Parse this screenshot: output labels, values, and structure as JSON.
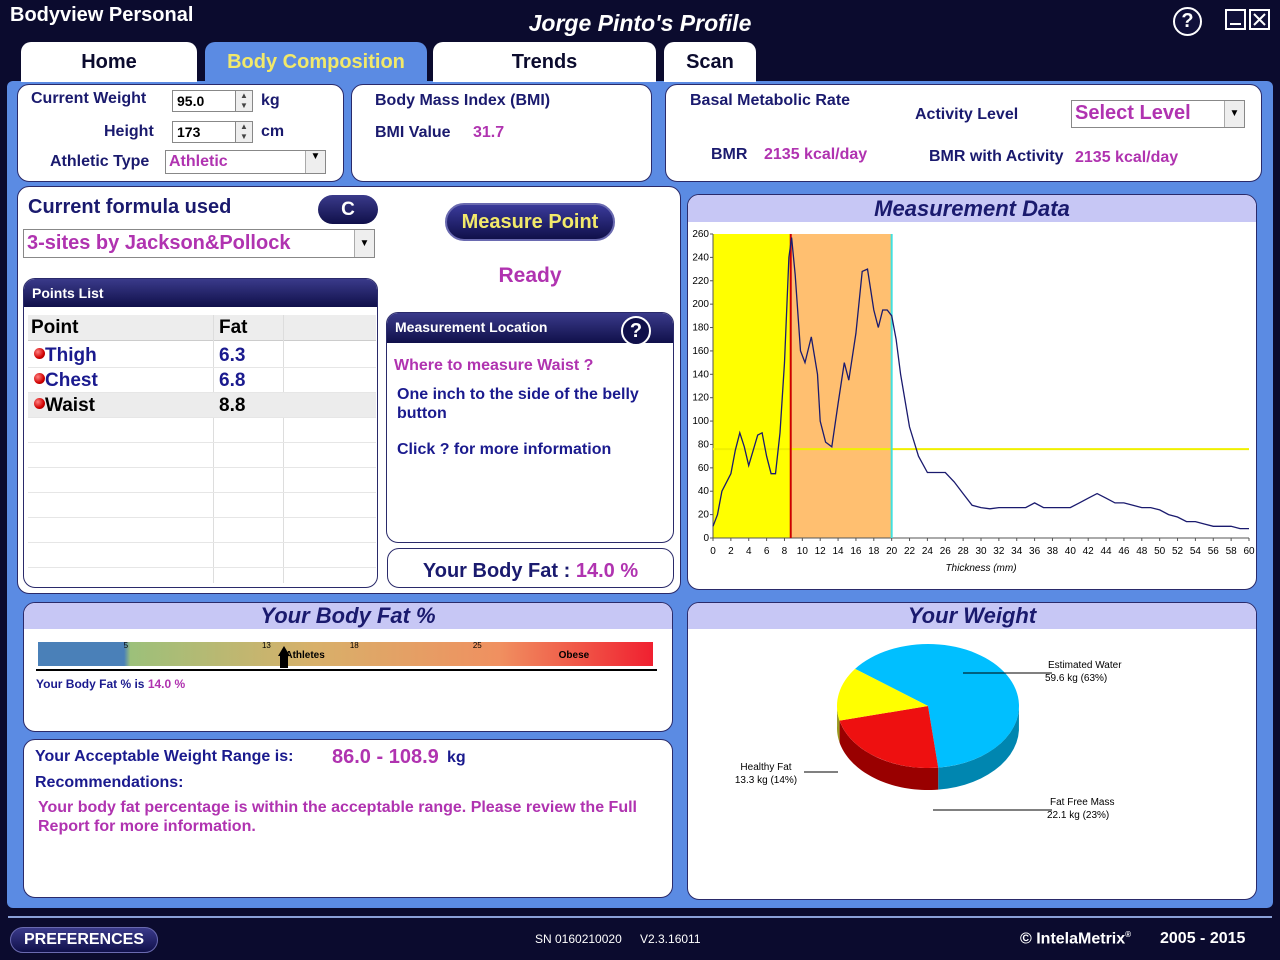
{
  "window": {
    "app_name": "Bodyview Personal",
    "profile_title": "Jorge Pinto's Profile",
    "help": "?"
  },
  "tabs": [
    {
      "label": "Home"
    },
    {
      "label": "Body Composition",
      "active": true
    },
    {
      "label": "Trends"
    },
    {
      "label": "Scan"
    }
  ],
  "inputs": {
    "weight_label": "Current Weight",
    "weight_value": "95.0",
    "weight_unit": "kg",
    "height_label": "Height",
    "height_value": "173",
    "height_unit": "cm",
    "athletic_label": "Athletic Type",
    "athletic_value": "Athletic"
  },
  "bmi": {
    "title": "Body Mass Index (BMI)",
    "value_label": "BMI Value",
    "value": "31.7"
  },
  "bmr": {
    "title": "Basal Metabolic Rate",
    "activity_label": "Activity Level",
    "activity_value": "Select Level",
    "bmr_label": "BMR",
    "bmr_value": "2135 kcal/day",
    "bmr_activity_label": "BMR with Activity",
    "bmr_activity_value": "2135 kcal/day"
  },
  "formula": {
    "title": "Current formula used",
    "button": "C",
    "value": "3-sites by Jackson&Pollock"
  },
  "measure": {
    "button": "Measure Point",
    "status": "Ready"
  },
  "points": {
    "title": "Points List",
    "columns": [
      "Point",
      "Fat"
    ],
    "rows": [
      {
        "point": "Thigh",
        "fat": "6.3"
      },
      {
        "point": "Chest",
        "fat": "6.8"
      },
      {
        "point": "Waist",
        "fat": "8.8"
      }
    ]
  },
  "location": {
    "title": "Measurement Location",
    "help": "?",
    "question": "Where to measure Waist ?",
    "answer": "One inch to the side of the belly button",
    "more": "Click ? for more information"
  },
  "body_fat_result": {
    "label": "Your Body Fat :",
    "value": "14.0 %"
  },
  "chart_data": {
    "type": "line",
    "title": "Measurement Data",
    "xlabel": "Thickness (mm)",
    "ylabel": "",
    "xlim": [
      0,
      60
    ],
    "ylim": [
      0,
      260
    ],
    "x_ticks": [
      "0",
      "2",
      "4",
      "6",
      "8",
      "10",
      "12",
      "14",
      "16",
      "18",
      "20",
      "22",
      "24",
      "26",
      "28",
      "30",
      "32",
      "34",
      "36",
      "38",
      "40",
      "42",
      "44",
      "46",
      "48",
      "50",
      "52",
      "54",
      "56",
      "58",
      "60"
    ],
    "y_ticks": [
      "0",
      "20",
      "40",
      "60",
      "80",
      "100",
      "120",
      "140",
      "160",
      "180",
      "200",
      "220",
      "240",
      "260"
    ],
    "regions": [
      {
        "from": 0,
        "to": 8.7,
        "color": "#ffff00"
      },
      {
        "from": 8.7,
        "to": 20,
        "color": "#ffbf70"
      }
    ],
    "markers": [
      {
        "x": 8.7,
        "color": "#cc0000"
      },
      {
        "x": 20,
        "color": "#40e0e0"
      }
    ],
    "threshold": {
      "y": 76,
      "color": "#f0f000"
    },
    "series": [
      {
        "color": "#1a1a6e",
        "x": [
          0,
          0.5,
          1,
          2,
          2.5,
          3,
          3.5,
          4,
          4.5,
          5,
          5.5,
          6,
          6.5,
          7,
          7.5,
          8,
          8.5,
          8.8,
          9.2,
          9.8,
          10.3,
          11,
          11.7,
          12,
          12.6,
          13.3,
          14,
          14.7,
          15.2,
          16,
          16.7,
          17.3,
          18,
          18.5,
          19,
          19.5,
          20,
          20.5,
          21,
          22,
          23,
          24,
          25,
          26,
          27,
          28,
          29,
          30,
          31,
          32,
          33,
          34,
          35,
          36,
          37,
          38,
          39,
          40,
          41,
          42,
          43,
          44,
          45,
          46,
          47,
          48,
          49,
          50,
          51,
          52,
          53,
          54,
          55,
          56,
          57,
          58,
          59,
          60
        ],
        "y": [
          10,
          20,
          40,
          55,
          75,
          90,
          78,
          62,
          75,
          88,
          90,
          70,
          55,
          55,
          90,
          150,
          240,
          257,
          225,
          160,
          150,
          172,
          140,
          100,
          82,
          78,
          115,
          150,
          135,
          175,
          228,
          230,
          195,
          180,
          195,
          195,
          190,
          170,
          140,
          95,
          70,
          56,
          56,
          56,
          48,
          38,
          28,
          26,
          25,
          26,
          26,
          26,
          26,
          30,
          26,
          26,
          26,
          26,
          30,
          34,
          38,
          34,
          30,
          30,
          28,
          26,
          26,
          24,
          20,
          18,
          14,
          14,
          12,
          10,
          10,
          10,
          8,
          8
        ]
      }
    ]
  },
  "fat_scale": {
    "title": "Your Body Fat %",
    "ticks": [
      "5",
      "13",
      "18",
      "25"
    ],
    "tick_values": [
      5,
      13,
      18,
      25
    ],
    "range": [
      0,
      35
    ],
    "athletes_label": "Athletes",
    "obese_label": "Obese",
    "pointer_value": 14.0,
    "summary_label": "Your Body Fat % is",
    "summary_value": "14.0 %"
  },
  "weight_range": {
    "label": "Your Acceptable Weight Range is:",
    "value": "86.0 - 108.9",
    "unit": "kg",
    "rec_label": "Recommendations:",
    "rec_text": "Your body fat percentage is within the acceptable range. Please review the Full Report for more information."
  },
  "weight_pie": {
    "title": "Your Weight",
    "slices": [
      {
        "label": "Estimated Water",
        "value": "59.6 kg (63%)",
        "pct": 63,
        "color": "#00bfff"
      },
      {
        "label": "Fat Free Mass",
        "value": "22.1 kg (23%)",
        "pct": 23,
        "color": "#ee1010"
      },
      {
        "label": "Healthy Fat",
        "value": "13.3 kg (14%)",
        "pct": 14,
        "color": "#ffff00"
      }
    ]
  },
  "footer": {
    "preferences": "PREFERENCES",
    "serial": "SN 0160210020",
    "version": "V2.3.16011",
    "copyright": "© IntelaMetrix",
    "tm": "®",
    "years": "2005 - 2015"
  }
}
